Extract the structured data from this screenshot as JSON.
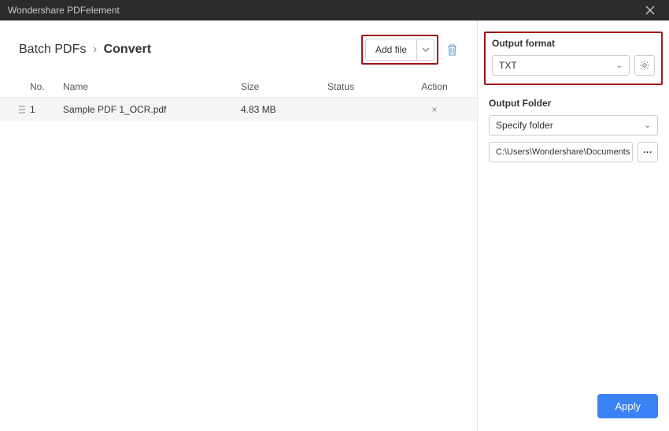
{
  "titlebar": {
    "title": "Wondershare PDFelement"
  },
  "breadcrumb": {
    "parent": "Batch PDFs",
    "current": "Convert"
  },
  "toolbar": {
    "addFileLabel": "Add file"
  },
  "table": {
    "headers": {
      "no": "No.",
      "name": "Name",
      "size": "Size",
      "status": "Status",
      "action": "Action"
    },
    "rows": [
      {
        "no": "1",
        "name": "Sample PDF 1_OCR.pdf",
        "size": "4.83 MB",
        "status": "",
        "action": "×"
      }
    ]
  },
  "rightPanel": {
    "outputFormatLabel": "Output format",
    "outputFormatValue": "TXT",
    "outputFolderLabel": "Output Folder",
    "folderSelectValue": "Specify folder",
    "folderPath": "C:\\Users\\Wondershare\\Documents",
    "applyLabel": "Apply"
  }
}
